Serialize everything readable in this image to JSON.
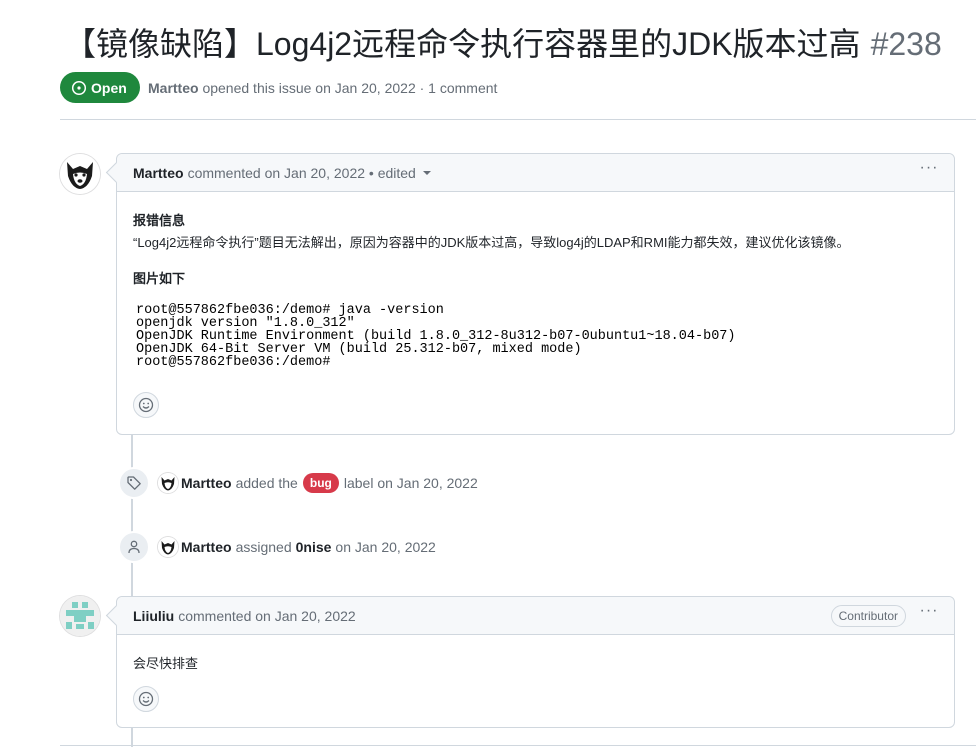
{
  "issue": {
    "title": "【镜像缺陷】Log4j2远程命令执行容器里的JDK版本过高",
    "number": "#238",
    "state": "Open",
    "author": "Martteo",
    "opened_text": "opened this issue on Jan 20, 2022 · 1 comment"
  },
  "comments": [
    {
      "author": "Martteo",
      "meta": "commented on Jan 20, 2022 • edited",
      "heading1": "报错信息",
      "text": "“Log4j2远程命令执行”题目无法解出，原因为容器中的JDK版本过高，导致log4j的LDAP和RMI能力都失效，建议优化该镜像。",
      "heading2": "图片如下",
      "code_lines": [
        "root@557862fbe036:/demo# java -version",
        "openjdk version \"1.8.0_312\"",
        "OpenJDK Runtime Environment (build 1.8.0_312-8u312-b07-0ubuntu1~18.04-b07)",
        "OpenJDK 64-Bit Server VM (build 25.312-b07, mixed mode)",
        "root@557862fbe036:/demo#"
      ]
    },
    {
      "author": "Liiuliu",
      "meta": "commented on Jan 20, 2022",
      "role": "Contributor",
      "text": "会尽快排查"
    }
  ],
  "events": [
    {
      "icon": "tag-icon",
      "actor": "Martteo",
      "text_before": "added the",
      "label": "bug",
      "text_after": "label on Jan 20, 2022"
    },
    {
      "icon": "person-icon",
      "actor": "Martteo",
      "text_before": "assigned",
      "assignee": "0nise",
      "text_after": "on Jan 20, 2022"
    }
  ],
  "menu_glyph": "···",
  "colors": {
    "open_green": "#1f883d",
    "bug_red": "#d73a4a",
    "border": "#d0d7de",
    "muted": "#656d76"
  }
}
